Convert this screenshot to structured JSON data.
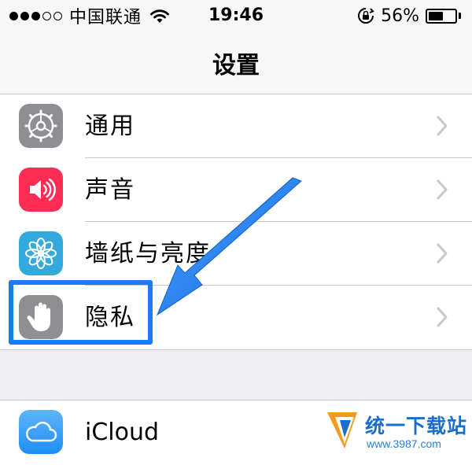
{
  "status_bar": {
    "carrier": "中国联通",
    "time": "19:46",
    "battery_percent": "56%",
    "battery_level": 0.56,
    "signal_bars_filled": 3,
    "signal_bars_total": 5
  },
  "nav": {
    "title": "设置"
  },
  "settings": {
    "items": [
      {
        "label": "通用",
        "icon": "gear-icon",
        "icon_color": "#8e8e93"
      },
      {
        "label": "声音",
        "icon": "speaker-icon",
        "icon_color": "#ff2d55"
      },
      {
        "label": "墙纸与亮度",
        "icon": "flower-icon",
        "icon_color": "#34aadc"
      },
      {
        "label": "隐私",
        "icon": "hand-icon",
        "icon_color": "#8e8e93"
      }
    ],
    "items2": [
      {
        "label": "iCloud",
        "icon": "cloud-icon",
        "icon_color": "#1e8cf5"
      }
    ]
  },
  "annotation": {
    "color": "#1a7cf0"
  },
  "watermark": {
    "brand": "统一下载站",
    "url": "www.3987.com"
  }
}
